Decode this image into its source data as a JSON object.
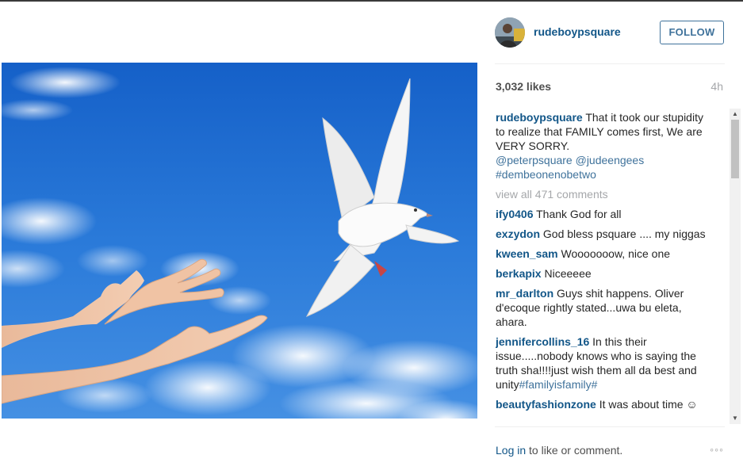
{
  "post": {
    "username": "rudeboypsquare",
    "follow_label": "FOLLOW",
    "likes": "3,032 likes",
    "time": "4h",
    "image_alt": "White dove flying from open hands against a blue sky"
  },
  "caption": {
    "user": "rudeboypsquare",
    "text": "That it took our stupidity to realize that FAMILY comes first, We are VERY SORRY.",
    "mention1": "@peterpsquare",
    "mention2": "@judeengees",
    "hashtag": "#dembeonenobetwo"
  },
  "view_all": "view all 471 comments",
  "comments": [
    {
      "user": "ify0406",
      "text": "Thank God for all"
    },
    {
      "user": "exzydon",
      "text": "God bless psquare .... my niggas"
    },
    {
      "user": "kween_sam",
      "text": "Wooooooow, nice one"
    },
    {
      "user": "berkapix",
      "text": "Niceeeee"
    },
    {
      "user": "mr_darlton",
      "text": "Guys shit happens. Oliver d'ecoque rightly stated...uwa bu eleta, ahara."
    },
    {
      "user": "jennifercollins_16",
      "text": "In this their issue.....nobody knows who is saying the truth sha!!!!just wish them all da best and unity",
      "tag1": "#familyisfamily",
      "tag2": "#"
    },
    {
      "user": "beautyfashionzone",
      "text": "It was about time ☺"
    }
  ],
  "footer": {
    "login": "Log in",
    "rest": " to like or comment.",
    "more": "◦◦◦"
  },
  "colors": {
    "username": "#125688",
    "follow_border": "#3f729b",
    "sky_top": "#1a63c9",
    "sky_bottom": "#3f8de6"
  },
  "icons": {
    "scroll_up": "triangle-up",
    "scroll_down": "triangle-down",
    "more": "three-dots"
  }
}
